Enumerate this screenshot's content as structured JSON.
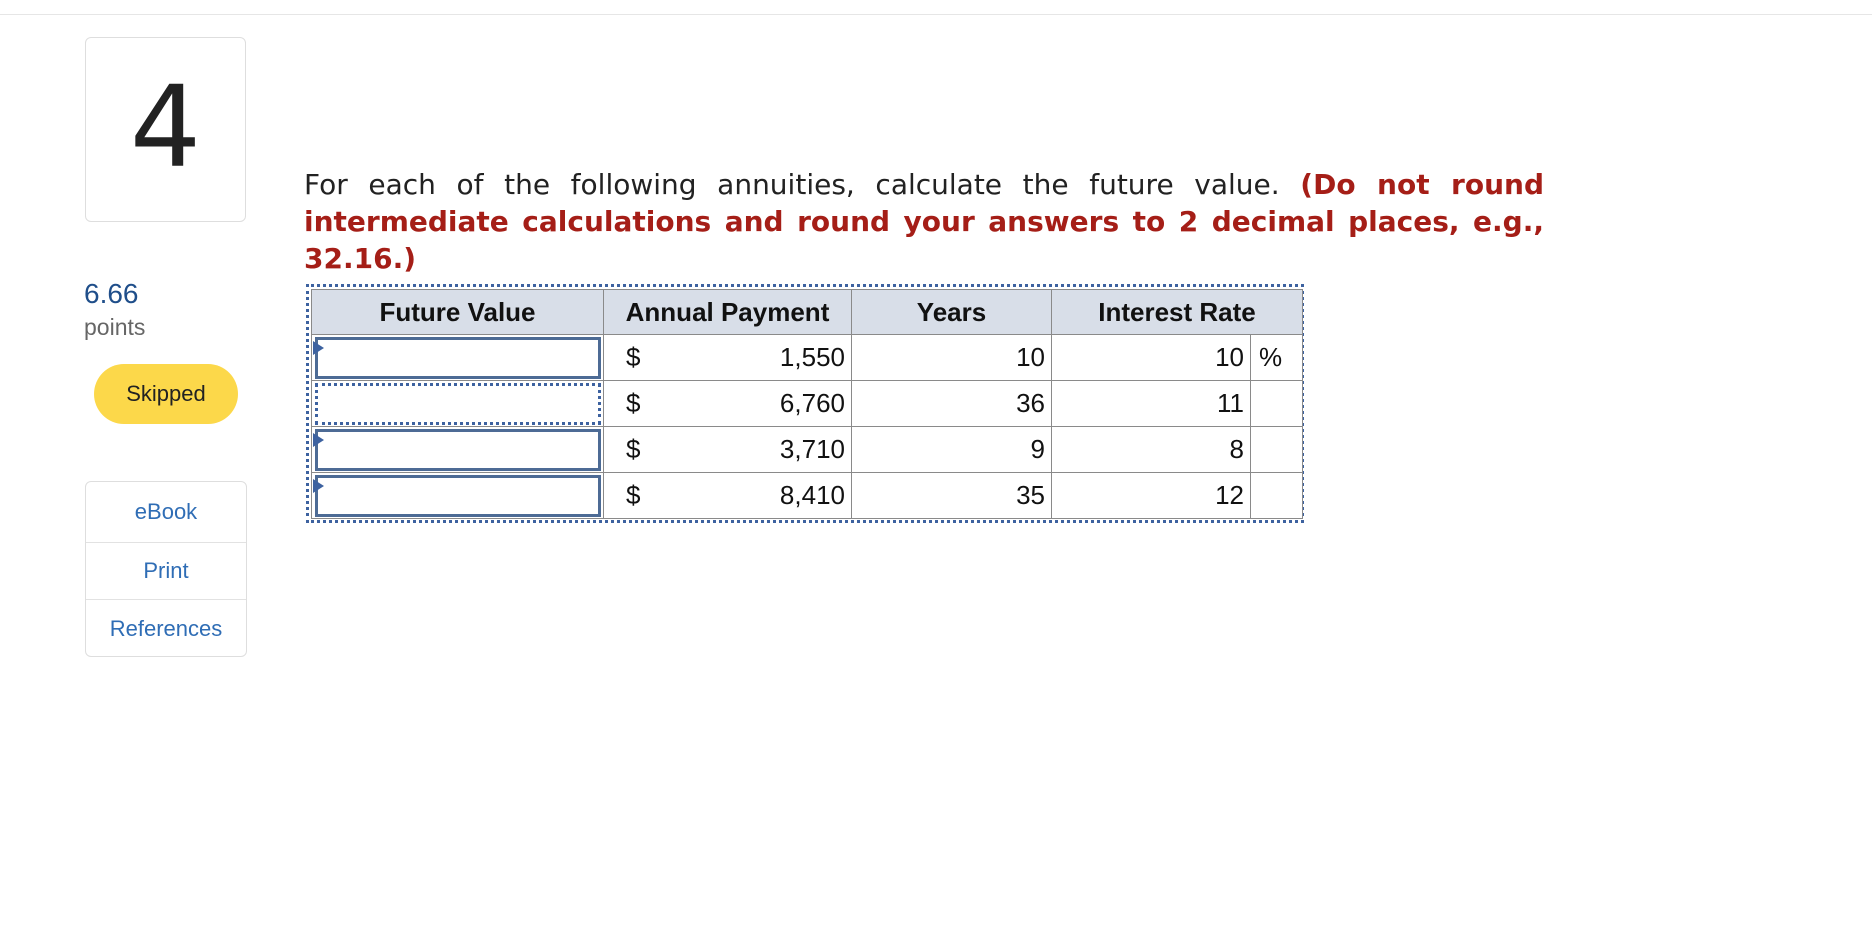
{
  "question": {
    "number": "4",
    "points_value": "6.66",
    "points_label": "points",
    "status": "Skipped",
    "text": "For each of the following annuities, calculate the future value.",
    "instruction": "(Do not round intermediate calculations and round your answers to 2 decimal places, e.g., 32.16.)"
  },
  "links": [
    {
      "label": "eBook"
    },
    {
      "label": "Print"
    },
    {
      "label": "References"
    }
  ],
  "table": {
    "headers": [
      "Future Value",
      "Annual Payment",
      "Years",
      "Interest Rate"
    ],
    "currency_symbol": "$",
    "percent_symbol": "%",
    "rows": [
      {
        "future_value": "",
        "payment": "1,550",
        "years": "10",
        "rate": "10"
      },
      {
        "future_value": "",
        "payment": "6,760",
        "years": "36",
        "rate": "11"
      },
      {
        "future_value": "",
        "payment": "3,710",
        "years": "9",
        "rate": "8"
      },
      {
        "future_value": "",
        "payment": "8,410",
        "years": "35",
        "rate": "12"
      }
    ]
  },
  "colors": {
    "accent_blue": "#2f6db5",
    "instruction_red": "#a51e17",
    "status_yellow": "#fcd84a",
    "header_bg": "#d8dee8"
  }
}
